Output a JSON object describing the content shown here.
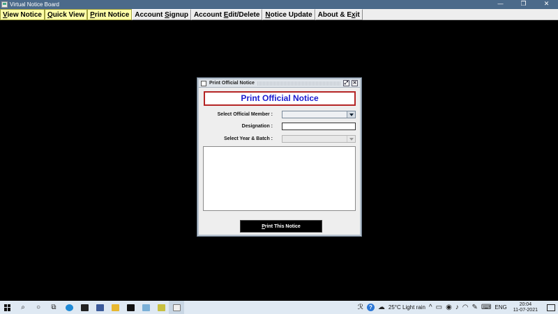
{
  "window": {
    "title": "Virtual Notice Board",
    "minimize_glyph": "—",
    "restore_glyph": "❐",
    "close_glyph": "✕"
  },
  "menu": {
    "items": [
      {
        "pre": "",
        "key": "V",
        "post": "iew Notice",
        "highlighted": true
      },
      {
        "pre": "",
        "key": "Q",
        "post": "uick View",
        "highlighted": true
      },
      {
        "pre": "",
        "key": "P",
        "post": "rint Notice",
        "highlighted": true
      },
      {
        "pre": "Account ",
        "key": "S",
        "post": "ignup",
        "highlighted": false
      },
      {
        "pre": "Account ",
        "key": "E",
        "post": "dit/Delete",
        "highlighted": false
      },
      {
        "pre": "",
        "key": "N",
        "post": "otice Update",
        "highlighted": false
      },
      {
        "pre": "About & E",
        "key": "x",
        "post": "it",
        "highlighted": false
      }
    ]
  },
  "dialog": {
    "title": "Print Official Notice",
    "heading": "Print Official Notice",
    "maximize_glyph": "⤢",
    "close_glyph": "✕",
    "fields": {
      "member_label": "Select Official Member :",
      "member_value": "",
      "designation_label": "Designation :",
      "designation_value": "",
      "year_label": "Select Year & Batch :",
      "year_value": ""
    },
    "notice_text": "",
    "print_button": {
      "key": "P",
      "rest": "rint This Notice"
    }
  },
  "taskbar": {
    "search_glyph": "○",
    "weather": "25°C  Light rain",
    "tray_caret": "^",
    "language": "ENG",
    "time": "20:04",
    "date": "11-07-2021"
  },
  "colors": {
    "heading_text": "#1a1ad0",
    "heading_border": "#b52525",
    "menu_highlight": "#ffffa8",
    "taskbar": "#dfe9f3"
  }
}
